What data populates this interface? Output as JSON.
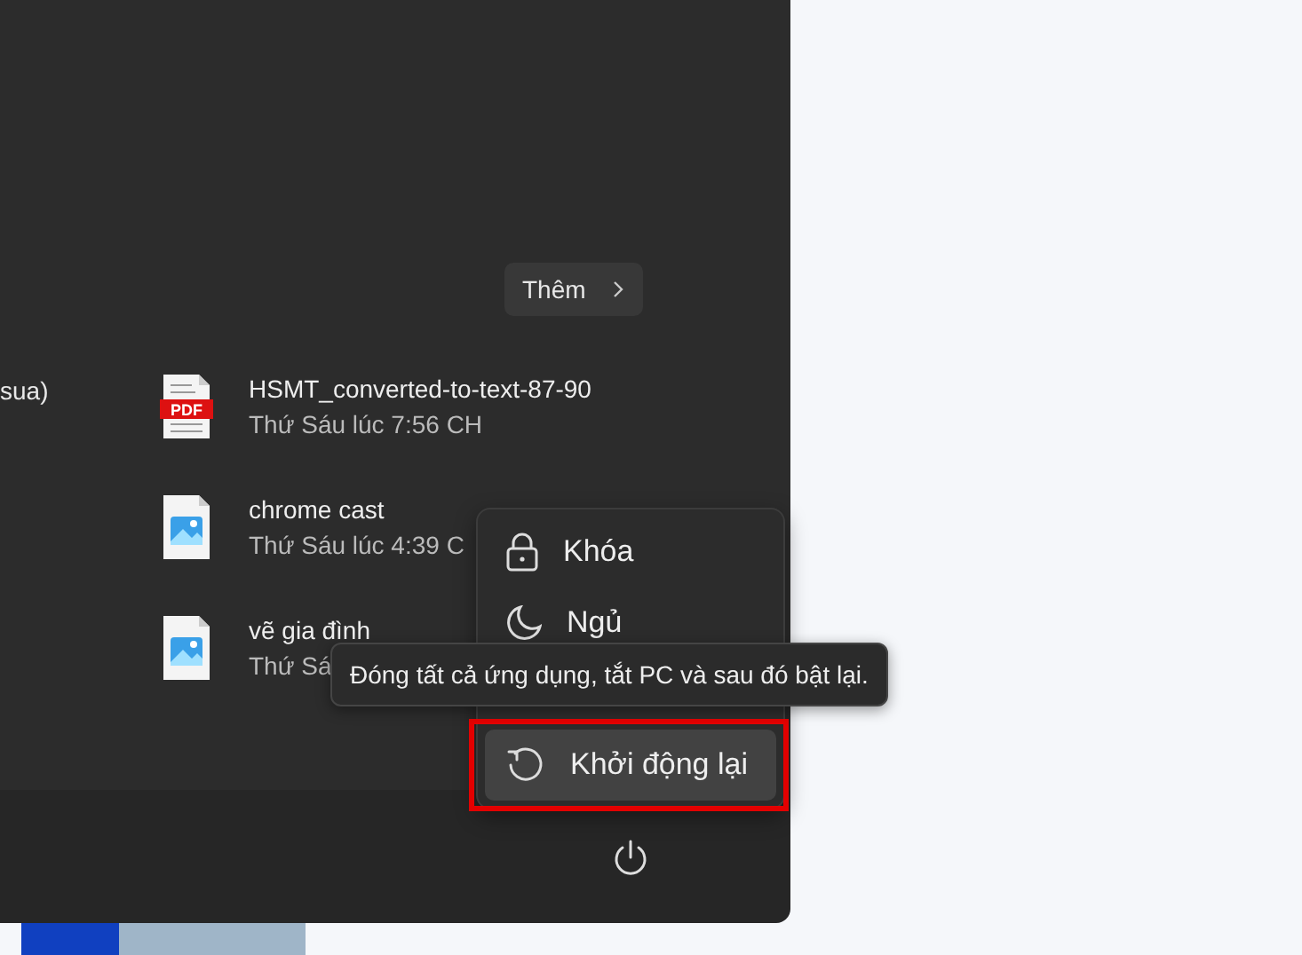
{
  "more_button": {
    "label": "Thêm"
  },
  "left_column_text": "sua)",
  "recommended": [
    {
      "kind": "pdf",
      "icon_label": "PDF",
      "name": "HSMT_converted-to-text-87-90",
      "time": "Thứ Sáu lúc 7:56 CH"
    },
    {
      "kind": "image",
      "name": "chrome cast",
      "time": "Thứ Sáu lúc 4:39 C"
    },
    {
      "kind": "image",
      "name": "vẽ gia đình",
      "time": "Thứ Sá"
    }
  ],
  "power_menu": [
    {
      "kind": "lock",
      "label": "Khóa",
      "selected": false
    },
    {
      "kind": "sleep",
      "label": "Ngủ",
      "selected": false
    },
    {
      "kind": "restart",
      "label": "Khởi động lại",
      "selected": true
    }
  ],
  "tooltip": "Đóng tất cả ứng dụng, tắt PC và sau đó bật lại."
}
